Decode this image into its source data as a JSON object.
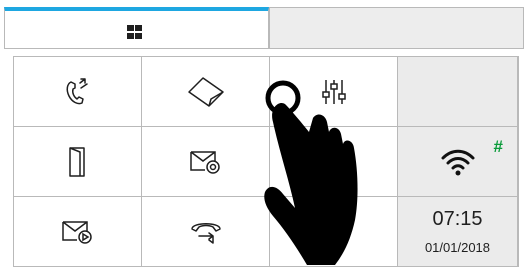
{
  "tabs": [
    {
      "icon": "grid-icon",
      "active": true
    },
    {
      "icon": "",
      "active": false
    }
  ],
  "accent_color": "#1ea7e1",
  "wifi_badge_color": "#0a9b3a",
  "grid": {
    "row1": [
      "call-transfer-icon",
      "door-opener-icon",
      "settings-sliders-icon",
      ""
    ],
    "row2": [
      "door-icon",
      "message-settings-icon",
      "",
      "wifi-icon"
    ],
    "row3": [
      "message-play-icon",
      "call-forward-icon",
      "",
      "clock"
    ]
  },
  "wifi": {
    "badge": "#"
  },
  "clock": {
    "time": "07:15",
    "date": "01/01/2018"
  },
  "overlay": {
    "icon": "pointing-hand-icon"
  }
}
